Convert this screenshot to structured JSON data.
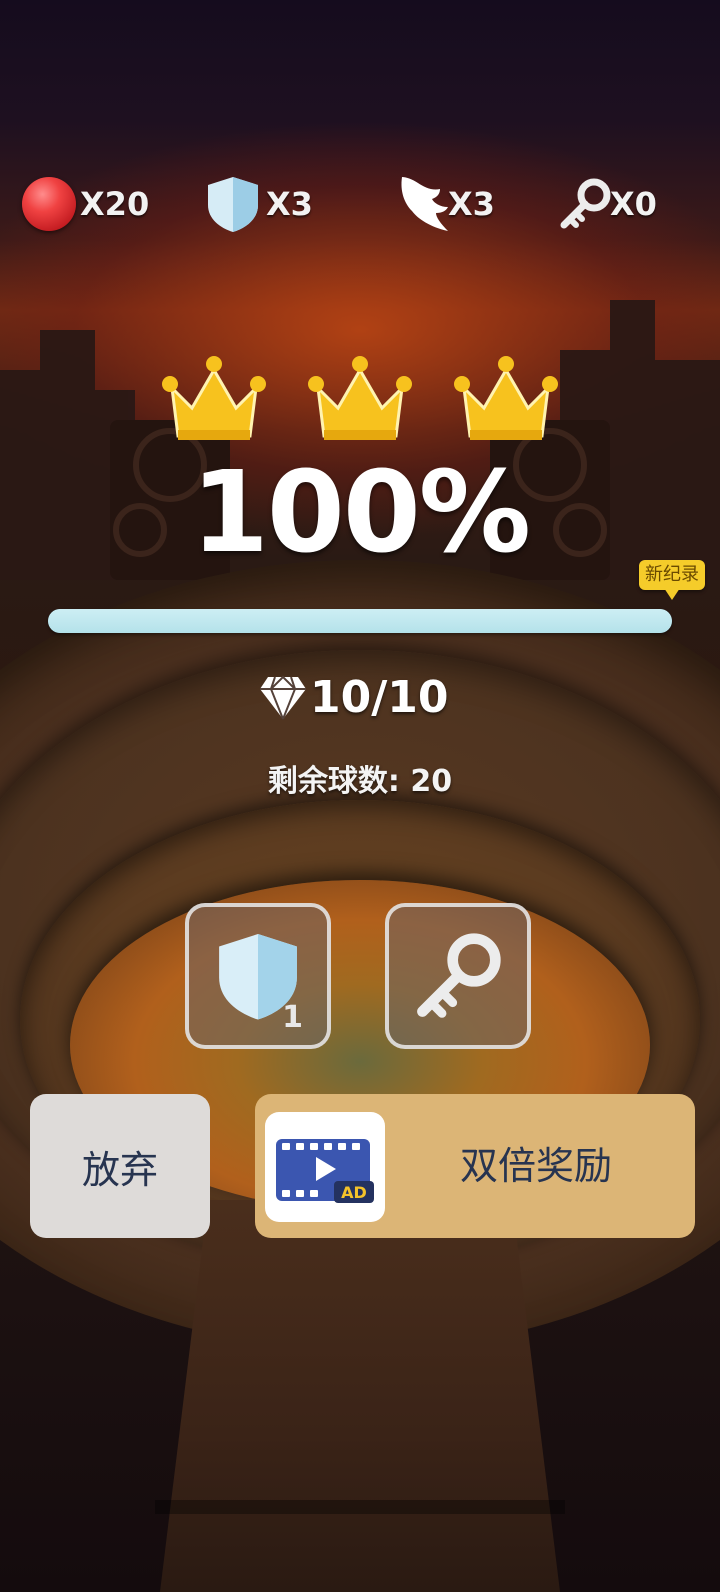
{
  "resources": {
    "balls": {
      "icon": "red-ball-icon",
      "count": "X20"
    },
    "shields": {
      "icon": "shield-icon",
      "count": "X3"
    },
    "wings": {
      "icon": "wing-icon",
      "count": "X3"
    },
    "keys": {
      "icon": "key-icon",
      "count": "X0"
    }
  },
  "result": {
    "crowns_earned": 3,
    "percent": "100%",
    "progress_fraction": 1.0,
    "new_record_badge": "新纪录",
    "gems": "10/10",
    "remaining_balls": "剩余球数: 20"
  },
  "items": {
    "shield": {
      "icon": "shield-icon",
      "count": "1"
    },
    "key": {
      "icon": "key-icon"
    }
  },
  "buttons": {
    "abandon": "放弃",
    "double_reward": "双倍奖励",
    "ad_tag": "AD"
  },
  "colors": {
    "crown": "#f7c21e",
    "progress": "#c6eaf1",
    "badge": "#f5cc2a",
    "double_button": "#dcb576",
    "abandon_button": "#dedbd9"
  }
}
